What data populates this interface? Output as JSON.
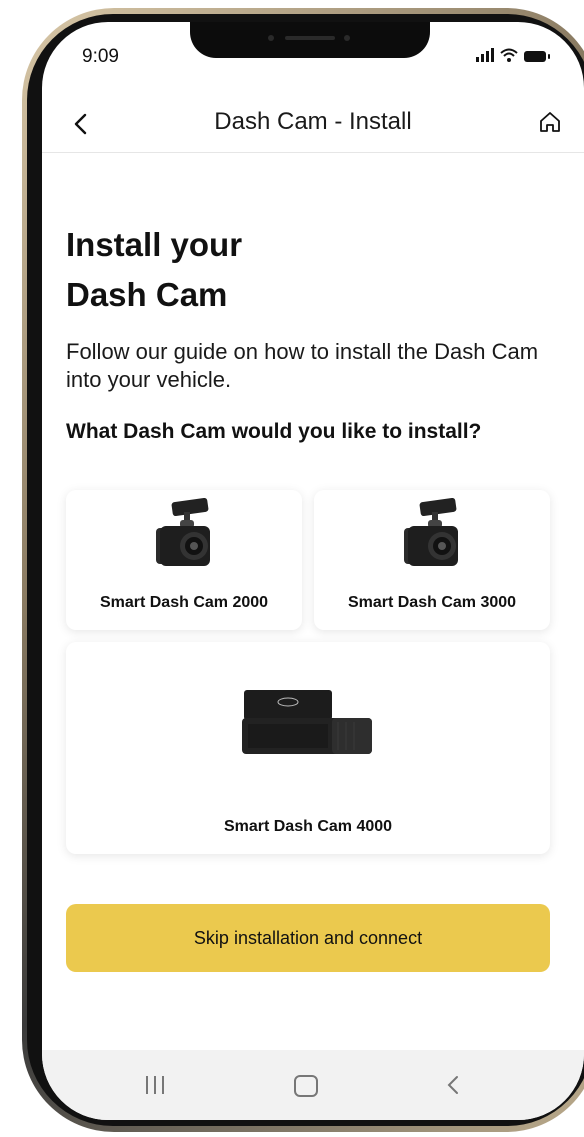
{
  "status_bar": {
    "time": "9:09"
  },
  "header": {
    "title": "Dash Cam - Install"
  },
  "main": {
    "headline_line1": "Install your",
    "headline_line2": "Dash Cam",
    "intro": "Follow our guide on how to install the Dash Cam into your vehicle.",
    "question": "What Dash Cam would you like to install?",
    "options": [
      {
        "label": "Smart Dash Cam 2000"
      },
      {
        "label": "Smart Dash Cam 3000"
      },
      {
        "label": "Smart Dash Cam 4000"
      }
    ],
    "skip_label": "Skip installation and connect"
  },
  "colors": {
    "accent": "#ebc94e",
    "text": "#111111",
    "nav_bar": "#f2f2f2"
  },
  "icons": {
    "back": "chevron-left-icon",
    "home": "home-icon",
    "signal": "signal-icon",
    "wifi": "wifi-icon",
    "battery": "battery-icon"
  }
}
